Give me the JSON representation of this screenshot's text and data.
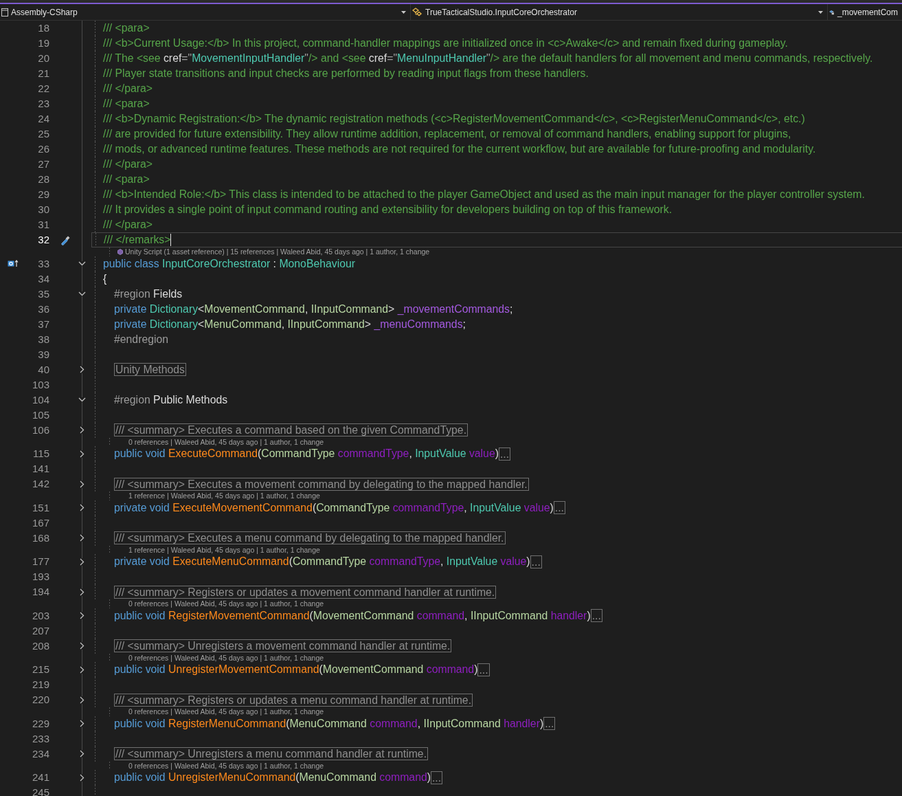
{
  "nav_bar": {
    "project": "Assembly-CSharp",
    "type": "TrueTacticalStudio.InputCoreOrchestrator",
    "member": "_movementCom"
  },
  "editor": {
    "lines": [
      {
        "number": "18",
        "current": false,
        "tokens": [
          {
            "kind": "comment",
            "s": "/// <para>"
          }
        ]
      },
      {
        "number": "19",
        "current": false,
        "tokens": [
          {
            "kind": "comment",
            "s": "/// <b>Current Usage:</b> In this project, command-handler mappings are initialized once in <c>Awake</c> and remain fixed during gameplay."
          }
        ]
      },
      {
        "number": "20",
        "current": false,
        "tokens": [
          {
            "kind": "comment",
            "s": "/// The <see "
          },
          {
            "kind": "attr",
            "s": "cref"
          },
          {
            "kind": "quote",
            "s": "=\""
          },
          {
            "kind": "type",
            "s": "MovementInputHandler"
          },
          {
            "kind": "quote",
            "s": "\""
          },
          {
            "kind": "comment",
            "s": "/> and <see "
          },
          {
            "kind": "attr",
            "s": "cref"
          },
          {
            "kind": "quote",
            "s": "=\""
          },
          {
            "kind": "type",
            "s": "MenuInputHandler"
          },
          {
            "kind": "quote",
            "s": "\""
          },
          {
            "kind": "comment",
            "s": "/> are the default handlers for all movement and menu commands, respectively."
          }
        ]
      },
      {
        "number": "21",
        "current": false,
        "tokens": [
          {
            "kind": "comment",
            "s": "/// Player state transitions and input checks are performed by reading input flags from these handlers."
          }
        ]
      },
      {
        "number": "22",
        "current": false,
        "tokens": [
          {
            "kind": "comment",
            "s": "/// </para>"
          }
        ]
      },
      {
        "number": "23",
        "current": false,
        "tokens": [
          {
            "kind": "comment",
            "s": "/// <para>"
          }
        ]
      },
      {
        "number": "24",
        "current": false,
        "tokens": [
          {
            "kind": "comment",
            "s": "/// <b>Dynamic Registration:</b> The dynamic registration methods (<c>RegisterMovementCommand</c>, <c>RegisterMenuCommand</c>, etc.)"
          }
        ]
      },
      {
        "number": "25",
        "current": false,
        "tokens": [
          {
            "kind": "comment",
            "s": "/// are provided for future extensibility. They allow runtime addition, replacement, or removal of command handlers, enabling support for plugins,"
          }
        ]
      },
      {
        "number": "26",
        "current": false,
        "tokens": [
          {
            "kind": "comment",
            "s": "/// mods, or advanced runtime features. These methods are not required for the current workflow, but are available for future-proofing and modularity."
          }
        ]
      },
      {
        "number": "27",
        "current": false,
        "tokens": [
          {
            "kind": "comment",
            "s": "/// </para>"
          }
        ]
      },
      {
        "number": "28",
        "current": false,
        "tokens": [
          {
            "kind": "comment",
            "s": "/// <para>"
          }
        ]
      },
      {
        "number": "29",
        "current": false,
        "tokens": [
          {
            "kind": "comment",
            "s": "/// <b>Intended Role:</b> This class is intended to be attached to the player GameObject and used as the main input manager for the player controller system."
          }
        ]
      },
      {
        "number": "30",
        "current": false,
        "tokens": [
          {
            "kind": "comment",
            "s": "/// It provides a single point of input command routing and extensibility for developers building on top of this framework."
          }
        ]
      },
      {
        "number": "31",
        "current": false,
        "tokens": [
          {
            "kind": "comment",
            "s": "/// </para>"
          }
        ]
      },
      {
        "number": "32",
        "current": true,
        "quick_action": true,
        "tokens": [
          {
            "kind": "comment",
            "s": "/// </remarks>"
          }
        ]
      },
      {
        "number": "33",
        "current": false,
        "expanded": true,
        "implements": true,
        "codelens": {
          "icon": true,
          "text": "Unity Script (1 asset reference) | 15 references | Waleed Abid, 45 days ago | 1 author, 1 change"
        },
        "tokens": [
          {
            "kind": "keyword",
            "s": "public class "
          },
          {
            "kind": "type",
            "s": "InputCoreOrchestrator"
          },
          {
            "kind": "plain",
            "s": " : "
          },
          {
            "kind": "type",
            "s": "MonoBehaviour"
          }
        ]
      },
      {
        "number": "34",
        "current": false,
        "tokens": [
          {
            "kind": "plain",
            "s": "{"
          }
        ],
        "children": [
          {
            "number": "35",
            "current": false,
            "expanded": true,
            "tokens": [
              {
                "kind": "region",
                "s": "#region "
              },
              {
                "kind": "plain",
                "s": "Fields"
              }
            ]
          },
          {
            "number": "36",
            "current": false,
            "tokens": [
              {
                "kind": "keyword",
                "s": "private "
              },
              {
                "kind": "type",
                "s": "Dictionary"
              },
              {
                "kind": "plain",
                "s": "<"
              },
              {
                "kind": "enum",
                "s": "MovementCommand"
              },
              {
                "kind": "plain",
                "s": ", "
              },
              {
                "kind": "enum",
                "s": "IInputCommand"
              },
              {
                "kind": "plain",
                "s": "> "
              },
              {
                "kind": "field",
                "s": "_movementCommands"
              },
              {
                "kind": "plain",
                "s": ";"
              }
            ]
          },
          {
            "number": "37",
            "current": false,
            "tokens": [
              {
                "kind": "keyword",
                "s": "private "
              },
              {
                "kind": "type",
                "s": "Dictionary"
              },
              {
                "kind": "plain",
                "s": "<"
              },
              {
                "kind": "enum",
                "s": "MenuCommand"
              },
              {
                "kind": "plain",
                "s": ", "
              },
              {
                "kind": "enum",
                "s": "IInputCommand"
              },
              {
                "kind": "plain",
                "s": "> "
              },
              {
                "kind": "field",
                "s": "_menuCommands"
              },
              {
                "kind": "plain",
                "s": ";"
              }
            ]
          },
          {
            "number": "38",
            "current": false,
            "tokens": [
              {
                "kind": "region",
                "s": "#endregion"
              }
            ]
          },
          {
            "number": "39",
            "current": false
          },
          {
            "number": "40",
            "current": false,
            "expanded": false,
            "tokens": [
              {
                "kind": "collapsed",
                "s": "Unity Methods"
              }
            ]
          },
          {
            "number": "103",
            "current": false
          },
          {
            "number": "104",
            "current": false,
            "expanded": true,
            "tokens": [
              {
                "kind": "region",
                "s": "#region "
              },
              {
                "kind": "plain",
                "s": "Public Methods"
              }
            ]
          },
          {
            "number": "105",
            "current": false
          },
          {
            "number": "106",
            "current": false,
            "expanded": false,
            "tokens": [
              {
                "kind": "collapsed",
                "s": "/// <summary> Executes a command based on the given CommandType."
              }
            ]
          },
          {
            "number": "115",
            "current": false,
            "expanded": false,
            "codelens": {
              "icon": false,
              "text": "0 references | Waleed Abid, 45 days ago | 1 author, 1 change"
            },
            "tokens": [
              {
                "kind": "keyword",
                "s": "public void "
              },
              {
                "kind": "method",
                "s": "ExecuteCommand"
              },
              {
                "kind": "plain",
                "s": "("
              },
              {
                "kind": "enum",
                "s": "CommandType "
              },
              {
                "kind": "param",
                "s": "commandType"
              },
              {
                "kind": "plain",
                "s": ", "
              },
              {
                "kind": "type",
                "s": "InputValue "
              },
              {
                "kind": "param",
                "s": "value"
              },
              {
                "kind": "plain",
                "s": ")"
              },
              {
                "kind": "collapsed",
                "s": "..."
              }
            ]
          },
          {
            "number": "141",
            "current": false
          },
          {
            "number": "142",
            "current": false,
            "expanded": false,
            "tokens": [
              {
                "kind": "collapsed",
                "s": "/// <summary> Executes a movement command by delegating to the mapped handler."
              }
            ]
          },
          {
            "number": "151",
            "current": false,
            "expanded": false,
            "codelens": {
              "icon": false,
              "text": "1 reference | Waleed Abid, 45 days ago | 1 author, 1 change"
            },
            "tokens": [
              {
                "kind": "keyword",
                "s": "private void "
              },
              {
                "kind": "method",
                "s": "ExecuteMovementCommand"
              },
              {
                "kind": "plain",
                "s": "("
              },
              {
                "kind": "enum",
                "s": "CommandType "
              },
              {
                "kind": "param",
                "s": "commandType"
              },
              {
                "kind": "plain",
                "s": ", "
              },
              {
                "kind": "type",
                "s": "InputValue "
              },
              {
                "kind": "param",
                "s": "value"
              },
              {
                "kind": "plain",
                "s": ")"
              },
              {
                "kind": "collapsed",
                "s": "..."
              }
            ]
          },
          {
            "number": "167",
            "current": false
          },
          {
            "number": "168",
            "current": false,
            "expanded": false,
            "tokens": [
              {
                "kind": "collapsed",
                "s": "/// <summary> Executes a menu command by delegating to the mapped handler."
              }
            ]
          },
          {
            "number": "177",
            "current": false,
            "expanded": false,
            "codelens": {
              "icon": false,
              "text": "1 reference | Waleed Abid, 45 days ago | 1 author, 1 change"
            },
            "tokens": [
              {
                "kind": "keyword",
                "s": "private void "
              },
              {
                "kind": "method",
                "s": "ExecuteMenuCommand"
              },
              {
                "kind": "plain",
                "s": "("
              },
              {
                "kind": "enum",
                "s": "CommandType "
              },
              {
                "kind": "param",
                "s": "commandType"
              },
              {
                "kind": "plain",
                "s": ", "
              },
              {
                "kind": "type",
                "s": "InputValue "
              },
              {
                "kind": "param",
                "s": "value"
              },
              {
                "kind": "plain",
                "s": ")"
              },
              {
                "kind": "collapsed",
                "s": "..."
              }
            ]
          },
          {
            "number": "193",
            "current": false
          },
          {
            "number": "194",
            "current": false,
            "expanded": false,
            "tokens": [
              {
                "kind": "collapsed",
                "s": "/// <summary> Registers or updates a movement command handler at runtime."
              }
            ]
          },
          {
            "number": "203",
            "current": false,
            "expanded": false,
            "codelens": {
              "icon": false,
              "text": "0 references | Waleed Abid, 45 days ago | 1 author, 1 change"
            },
            "tokens": [
              {
                "kind": "keyword",
                "s": "public void "
              },
              {
                "kind": "method",
                "s": "RegisterMovementCommand"
              },
              {
                "kind": "plain",
                "s": "("
              },
              {
                "kind": "enum",
                "s": "MovementCommand "
              },
              {
                "kind": "param",
                "s": "command"
              },
              {
                "kind": "plain",
                "s": ", "
              },
              {
                "kind": "enum",
                "s": "IInputCommand "
              },
              {
                "kind": "param",
                "s": "handler"
              },
              {
                "kind": "plain",
                "s": ")"
              },
              {
                "kind": "collapsed",
                "s": "..."
              }
            ]
          },
          {
            "number": "207",
            "current": false
          },
          {
            "number": "208",
            "current": false,
            "expanded": false,
            "tokens": [
              {
                "kind": "collapsed",
                "s": "/// <summary> Unregisters a movement command handler at runtime."
              }
            ]
          },
          {
            "number": "215",
            "current": false,
            "expanded": false,
            "codelens": {
              "icon": false,
              "text": "0 references | Waleed Abid, 45 days ago | 1 author, 1 change"
            },
            "tokens": [
              {
                "kind": "keyword",
                "s": "public void "
              },
              {
                "kind": "method",
                "s": "UnregisterMovementCommand"
              },
              {
                "kind": "plain",
                "s": "("
              },
              {
                "kind": "enum",
                "s": "MovementCommand "
              },
              {
                "kind": "param",
                "s": "command"
              },
              {
                "kind": "plain",
                "s": ")"
              },
              {
                "kind": "collapsed",
                "s": "..."
              }
            ]
          },
          {
            "number": "219",
            "current": false
          },
          {
            "number": "220",
            "current": false,
            "expanded": false,
            "tokens": [
              {
                "kind": "collapsed",
                "s": "/// <summary> Registers or updates a menu command handler at runtime."
              }
            ]
          },
          {
            "number": "229",
            "current": false,
            "expanded": false,
            "codelens": {
              "icon": false,
              "text": "0 references | Waleed Abid, 45 days ago | 1 author, 1 change"
            },
            "tokens": [
              {
                "kind": "keyword",
                "s": "public void "
              },
              {
                "kind": "method",
                "s": "RegisterMenuCommand"
              },
              {
                "kind": "plain",
                "s": "("
              },
              {
                "kind": "enum",
                "s": "MenuCommand "
              },
              {
                "kind": "param",
                "s": "command"
              },
              {
                "kind": "plain",
                "s": ", "
              },
              {
                "kind": "enum",
                "s": "IInputCommand "
              },
              {
                "kind": "param",
                "s": "handler"
              },
              {
                "kind": "plain",
                "s": ")"
              },
              {
                "kind": "collapsed",
                "s": "..."
              }
            ]
          },
          {
            "number": "233",
            "current": false
          },
          {
            "number": "234",
            "current": false,
            "expanded": false,
            "tokens": [
              {
                "kind": "collapsed",
                "s": "/// <summary> Unregisters a menu command handler at runtime."
              }
            ]
          },
          {
            "number": "241",
            "current": false,
            "expanded": false,
            "codelens": {
              "icon": false,
              "text": "0 references | Waleed Abid, 45 days ago | 1 author, 1 change"
            },
            "tokens": [
              {
                "kind": "keyword",
                "s": "public void "
              },
              {
                "kind": "method",
                "s": "UnregisterMenuCommand"
              },
              {
                "kind": "plain",
                "s": "("
              },
              {
                "kind": "enum",
                "s": "MenuCommand "
              },
              {
                "kind": "param",
                "s": "command"
              },
              {
                "kind": "plain",
                "s": ")"
              },
              {
                "kind": "collapsed",
                "s": "..."
              }
            ]
          },
          {
            "number": "245",
            "current": false
          }
        ]
      }
    ]
  }
}
